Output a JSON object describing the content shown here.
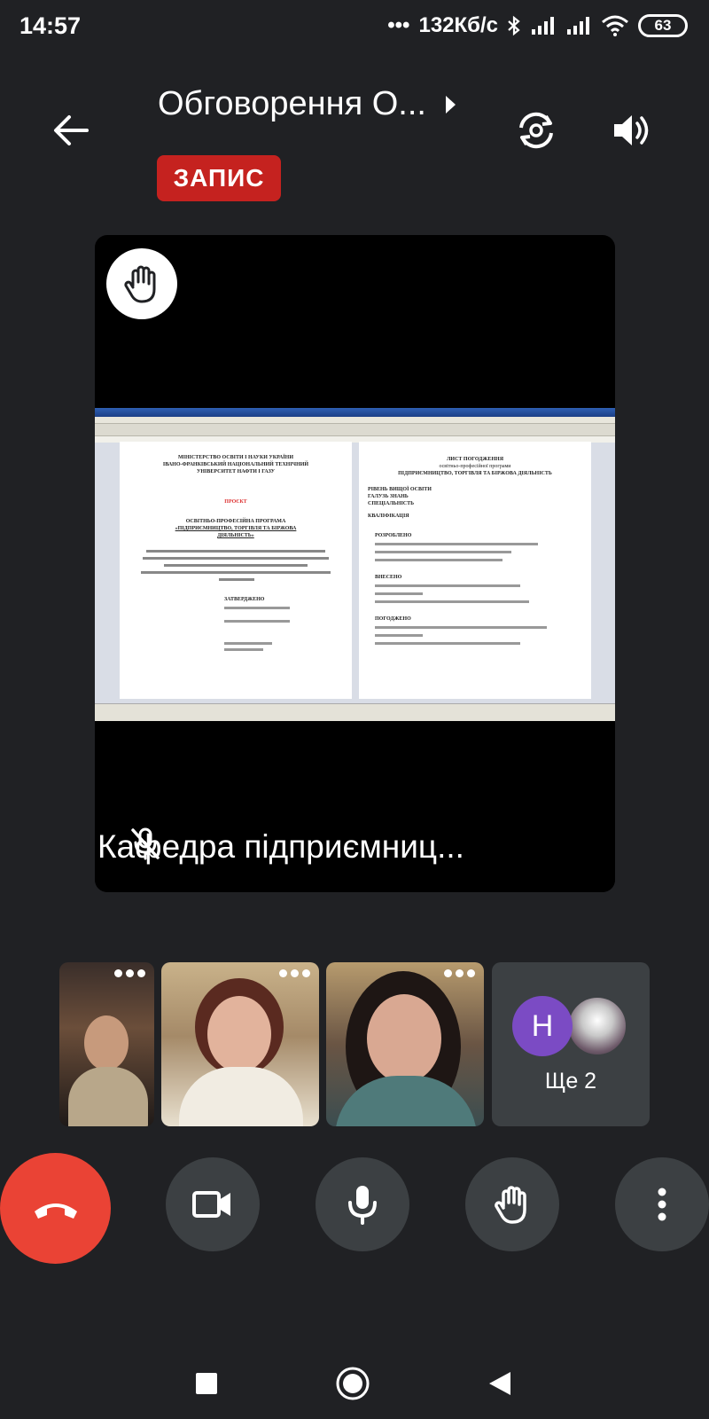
{
  "status_bar": {
    "time": "14:57",
    "network_speed": "132Кб/с",
    "battery": "63"
  },
  "header": {
    "title": "Обговорення О...",
    "recording_badge": "ЗАПИС"
  },
  "main_tile": {
    "participant_name": "Кафедра підприємниц...",
    "shared_document": {
      "left_page": [
        "МІНІСТЕРСТВО ОСВІТИ І НАУКИ УКРАЇНИ",
        "ІВАНО-ФРАНКІВСЬКИЙ НАЦІОНАЛЬНИЙ ТЕХНІЧНИЙ",
        "УНІВЕРСИТЕТ НАФТИ І ГАЗУ",
        "ПРОЄКТ",
        "ОСВІТНЬО-ПРОФЕСІЙНА ПРОГРАМА",
        "«ПІДПРИЄМНИЦТВО, ТОРГІВЛЯ ТА БІРЖОВА",
        "ДІЯЛЬНІСТЬ»",
        "ЗАТВЕРДЖЕНО"
      ],
      "right_page": [
        "ЛИСТ ПОГОДЖЕННЯ",
        "освітньо-професійної програми",
        "ПІДПРИЄМНИЦТВО, ТОРГІВЛЯ ТА БІРЖОВА ДІЯЛЬНІСТЬ",
        "РІВЕНЬ ВИЩОЇ ОСВІТИ",
        "ГАЛУЗЬ ЗНАНЬ",
        "СПЕЦІАЛЬНІСТЬ",
        "КВАЛІФІКАЦІЯ",
        "РОЗРОБЛЕНО",
        "ВНЕСЕНО",
        "ПОГОДЖЕНО"
      ]
    }
  },
  "participants": {
    "more_avatar_letter": "H",
    "more_label": "Ще 2"
  },
  "colors": {
    "background": "#202124",
    "record_badge": "#c5221f",
    "end_call": "#ea4335",
    "control_bg": "#3c4043",
    "avatar_purple": "#7b4bc4"
  },
  "icons": {
    "back": "arrow-left-icon",
    "switch_camera": "camera-switch-icon",
    "speaker": "speaker-icon",
    "raised_hand": "raised-hand-icon",
    "mic_off": "mic-off-icon",
    "end_call": "phone-hangup-icon",
    "camera": "videocam-icon",
    "mic": "mic-icon",
    "hand": "hand-icon",
    "menu": "more-vert-icon"
  }
}
